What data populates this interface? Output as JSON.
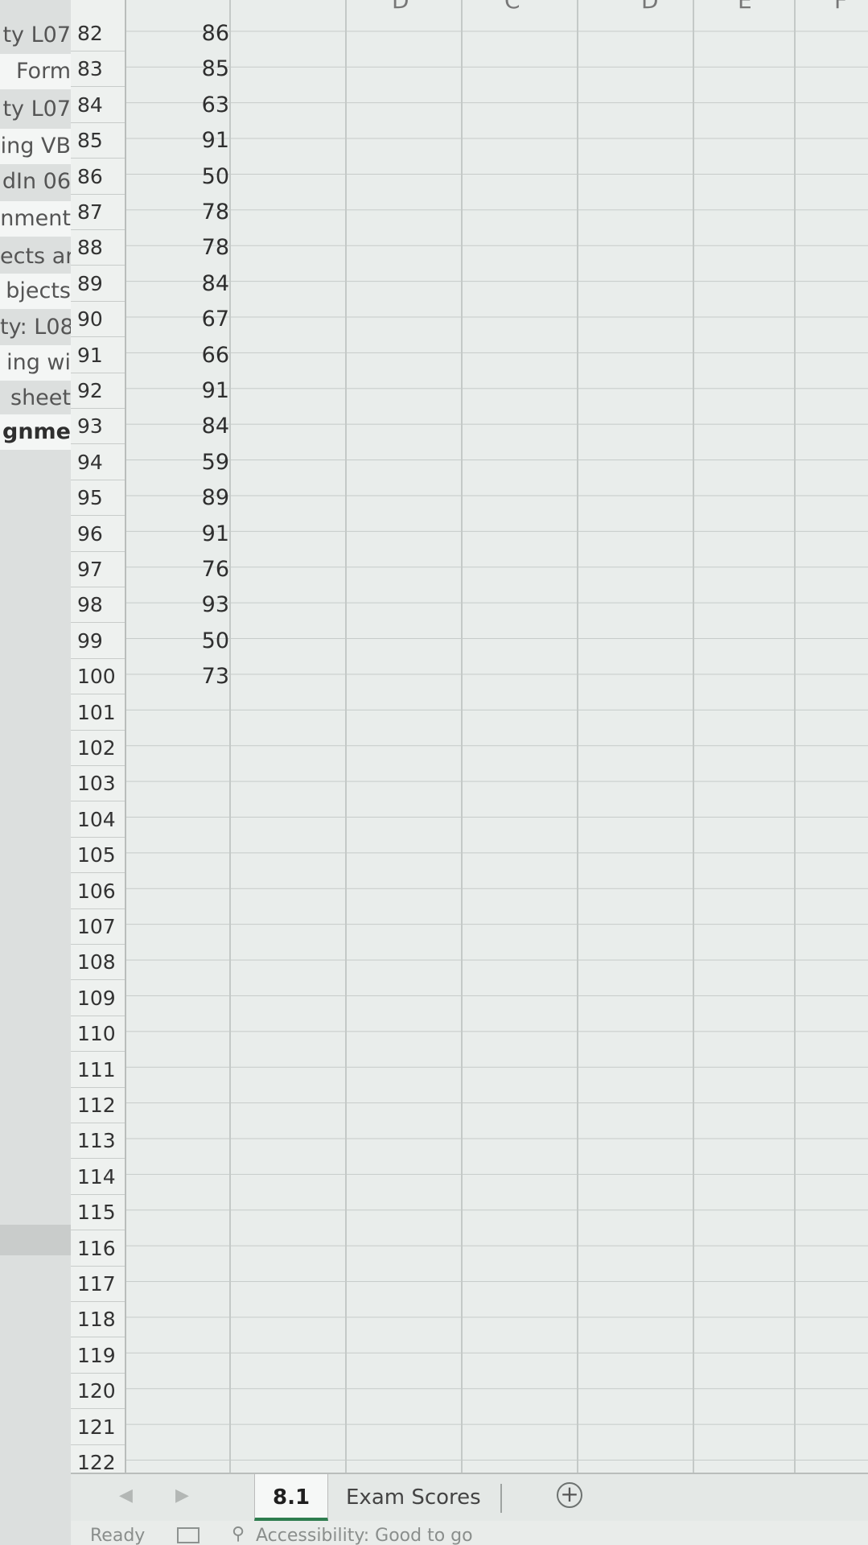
{
  "left_panel": {
    "items": [
      {
        "label": "ty L07",
        "white": false,
        "active": false
      },
      {
        "label": "Form",
        "white": true,
        "active": false
      },
      {
        "label": "ty L07",
        "white": false,
        "active": false
      },
      {
        "label": "ing VB",
        "white": true,
        "active": false
      },
      {
        "label": "dIn 06",
        "white": false,
        "active": false
      },
      {
        "label": "nment",
        "white": true,
        "active": false
      },
      {
        "label": "ects ar",
        "white": false,
        "active": false
      },
      {
        "label": "bjects",
        "white": true,
        "active": false
      },
      {
        "label": "ty: L08",
        "white": false,
        "active": false
      },
      {
        "label": "ing wi",
        "white": true,
        "active": false
      },
      {
        "label": "sheet",
        "white": false,
        "active": false
      },
      {
        "label": "gnme",
        "white": true,
        "active": true
      }
    ]
  },
  "columns": {
    "letters": [
      "D",
      "C",
      "D",
      "E",
      "F"
    ]
  },
  "rows": [
    {
      "num": "82",
      "b": "86"
    },
    {
      "num": "83",
      "b": "85"
    },
    {
      "num": "84",
      "b": "63"
    },
    {
      "num": "85",
      "b": "91"
    },
    {
      "num": "86",
      "b": "50"
    },
    {
      "num": "87",
      "b": "78"
    },
    {
      "num": "88",
      "b": "78"
    },
    {
      "num": "89",
      "b": "84"
    },
    {
      "num": "90",
      "b": "67"
    },
    {
      "num": "91",
      "b": "66"
    },
    {
      "num": "92",
      "b": "91"
    },
    {
      "num": "93",
      "b": "84"
    },
    {
      "num": "94",
      "b": "59"
    },
    {
      "num": "95",
      "b": "89"
    },
    {
      "num": "96",
      "b": "91"
    },
    {
      "num": "97",
      "b": "76"
    },
    {
      "num": "98",
      "b": "93"
    },
    {
      "num": "99",
      "b": "50"
    },
    {
      "num": "100",
      "b": "73"
    },
    {
      "num": "101",
      "b": ""
    },
    {
      "num": "102",
      "b": ""
    },
    {
      "num": "103",
      "b": ""
    },
    {
      "num": "104",
      "b": ""
    },
    {
      "num": "105",
      "b": ""
    },
    {
      "num": "106",
      "b": ""
    },
    {
      "num": "107",
      "b": ""
    },
    {
      "num": "108",
      "b": ""
    },
    {
      "num": "109",
      "b": ""
    },
    {
      "num": "110",
      "b": ""
    },
    {
      "num": "111",
      "b": ""
    },
    {
      "num": "112",
      "b": ""
    },
    {
      "num": "113",
      "b": ""
    },
    {
      "num": "114",
      "b": ""
    },
    {
      "num": "115",
      "b": ""
    },
    {
      "num": "116",
      "b": ""
    },
    {
      "num": "117",
      "b": ""
    },
    {
      "num": "118",
      "b": ""
    },
    {
      "num": "119",
      "b": ""
    },
    {
      "num": "120",
      "b": ""
    },
    {
      "num": "121",
      "b": ""
    },
    {
      "num": "122",
      "b": ""
    }
  ],
  "tabs": [
    {
      "label": "8.1",
      "active": true
    },
    {
      "label": "Exam Scores",
      "active": false
    }
  ],
  "add_sheet_label": "+",
  "status": {
    "ready": "Ready",
    "accessibility": "Accessibility: Good to go"
  }
}
